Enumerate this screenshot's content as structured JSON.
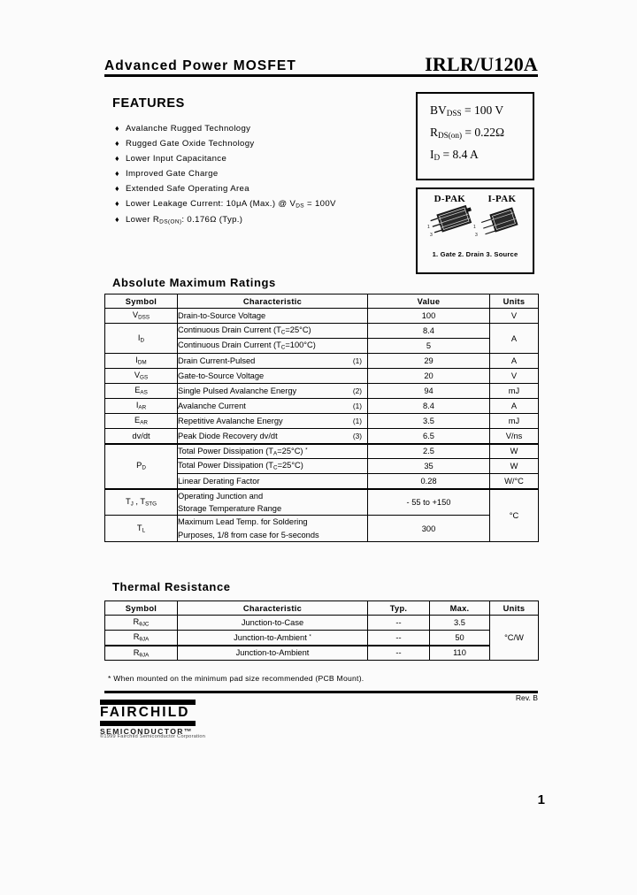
{
  "header": {
    "title_left": "Advanced  Power  MOSFET",
    "part_number": "IRLR/U120A"
  },
  "features": {
    "heading": "FEATURES",
    "bullet_glyph": "♦",
    "items": [
      {
        "text": "Avalanche  Rugged  Technology"
      },
      {
        "text": "Rugged  Gate  Oxide  Technology"
      },
      {
        "text": "Lower  Input  Capacitance"
      },
      {
        "text": "Improved  Gate  Charge"
      },
      {
        "text": "Extended  Safe  Operating  Area"
      },
      {
        "html": "Lower  Leakage  Current: 10μA (Max.)  @  V<sub>DS</sub> = 100V"
      },
      {
        "html": "Lower  R<sub>DS(ON)</sub>: 0.176Ω (Typ.)"
      }
    ]
  },
  "spec_box": {
    "lines": [
      {
        "html": "BV<sub>DSS</sub>  =  100 V"
      },
      {
        "html": "R<sub>DS(on)</sub> =  0.22Ω"
      },
      {
        "html": "I<sub>D</sub>  =  8.4 A"
      }
    ]
  },
  "package_box": {
    "left_label": "D-PAK",
    "right_label": "I-PAK",
    "caption": "1. Gate  2. Drain  3. Source"
  },
  "abs_max": {
    "section_title": "Absolute  Maximum  Ratings",
    "columns": [
      "Symbol",
      "Characteristic",
      "Value",
      "Units"
    ],
    "rows": [
      {
        "symbol_html": "V<sub>DSS</sub>",
        "characteristic_html": "Drain-to-Source Voltage",
        "note": "",
        "value": "100",
        "units": "V"
      },
      {
        "symbol_html": "I<sub>D</sub>",
        "characteristic_html": "Continuous  Drain  Current  (T<sub>C</sub>=25°C)",
        "note": "",
        "value": "8.4",
        "units": "A"
      },
      {
        "symbol_html": "",
        "characteristic_html": "Continuous  Drain  Current  (T<sub>C</sub>=100°C)",
        "note": "",
        "value": "5",
        "units": ""
      },
      {
        "symbol_html": "I<sub>DM</sub>",
        "characteristic_html": "Drain  Current-Pulsed",
        "note": "(1)",
        "value": "29",
        "units": "A"
      },
      {
        "symbol_html": "V<sub>GS</sub>",
        "characteristic_html": "Gate-to-Source  Voltage",
        "note": "",
        "value": "20",
        "units": "V"
      },
      {
        "symbol_html": "E<sub>AS</sub>",
        "characteristic_html": "Single  Pulsed  Avalanche  Energy",
        "note": "(2)",
        "value": "94",
        "units": "mJ"
      },
      {
        "symbol_html": "I<sub>AR</sub>",
        "characteristic_html": "Avalanche  Current",
        "note": "(1)",
        "value": "8.4",
        "units": "A"
      },
      {
        "symbol_html": "E<sub>AR</sub>",
        "characteristic_html": "Repetitive  Avalanche  Energy",
        "note": "(1)",
        "value": "3.5",
        "units": "mJ"
      },
      {
        "symbol_html": "dv/dt",
        "characteristic_html": "Peak  Diode  Recovery  dv/dt",
        "note": "(3)",
        "value": "6.5",
        "units": "V/ns"
      },
      {
        "symbol_html": "P<sub>D</sub>",
        "characteristic_html": "Total  Power  Dissipation  (T<sub>A</sub>=25°C) <sup>*</sup>",
        "note": "",
        "value": "2.5",
        "units": "W"
      },
      {
        "symbol_html": "",
        "characteristic_html": "Total  Power  Dissipation  (T<sub>C</sub>=25°C)",
        "note": "",
        "value": "35",
        "units": "W"
      },
      {
        "symbol_html": "",
        "characteristic_html": "Linear  Derating  Factor",
        "note": "",
        "value": "0.28",
        "units": "W/°C"
      },
      {
        "symbol_html": "T<sub>J</sub> , T<sub>STG</sub>",
        "characteristic_line1": "Operating  Junction  and",
        "characteristic_line2": "Storage  Temperature  Range",
        "note": "",
        "value": "- 55 to +150",
        "units": "°C"
      },
      {
        "symbol_html": "T<sub>L</sub>",
        "characteristic_line1": "Maximum  Lead  Temp.  for  Soldering",
        "characteristic_line2": "Purposes, 1/8   from  case  for  5-seconds",
        "note": "",
        "value": "300",
        "units": ""
      }
    ]
  },
  "thermal": {
    "section_title": "Thermal  Resistance",
    "columns": [
      "Symbol",
      "Characteristic",
      "Typ.",
      "Max.",
      "Units"
    ],
    "rows": [
      {
        "symbol_html": "R<sub>θJC</sub>",
        "characteristic_html": "Junction-to-Case",
        "typ": "--",
        "max": "3.5",
        "units": "°C/W"
      },
      {
        "symbol_html": "R<sub>θJA</sub>",
        "characteristic_html": "Junction-to-Ambient <sup>*</sup>",
        "typ": "--",
        "max": "50",
        "units": ""
      },
      {
        "symbol_html": "R<sub>θJA</sub>",
        "characteristic_html": "Junction-to-Ambient",
        "typ": "--",
        "max": "110",
        "units": ""
      }
    ],
    "footnote": "*   When  mounted  on  the  minimum  pad  size  recommended (PCB  Mount)."
  },
  "footer": {
    "revision": "Rev. B",
    "logo_name": "FAIRCHILD",
    "logo_sub": "SEMICONDUCTOR",
    "logo_sub_tm": "™",
    "copyright": "©1999 Fairchild Semiconductor Corporation",
    "page_number": "1"
  }
}
